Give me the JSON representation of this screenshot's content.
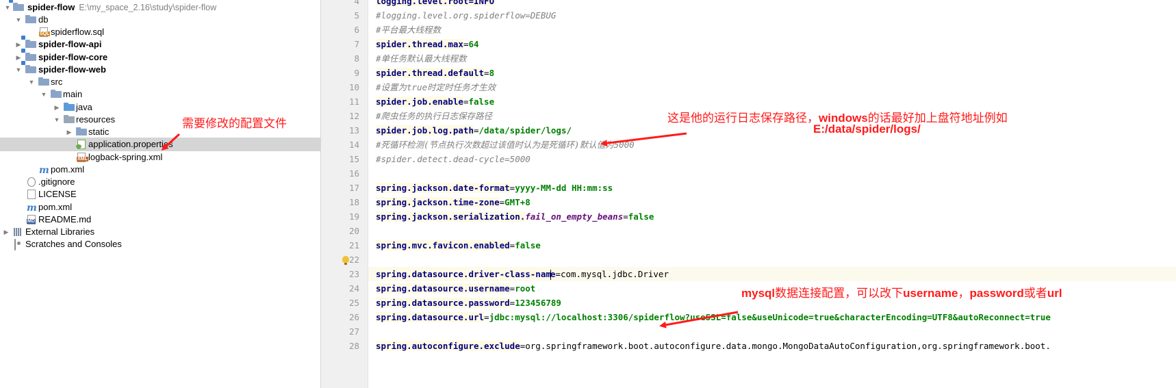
{
  "tree": {
    "root": {
      "name": "spider-flow",
      "path": "E:\\my_space_2.16\\study\\spider-flow"
    },
    "items": [
      {
        "label": "db"
      },
      {
        "label": "spiderflow.sql",
        "icon_tag": "SQL"
      },
      {
        "label": "spider-flow-api"
      },
      {
        "label": "spider-flow-core"
      },
      {
        "label": "spider-flow-web"
      },
      {
        "label": "src"
      },
      {
        "label": "main"
      },
      {
        "label": "java"
      },
      {
        "label": "resources"
      },
      {
        "label": "static"
      },
      {
        "label": "application.properties"
      },
      {
        "label": "logback-spring.xml",
        "icon_tag": "XML"
      },
      {
        "label": "pom.xml"
      },
      {
        "label": ".gitignore"
      },
      {
        "label": "LICENSE"
      },
      {
        "label": "pom.xml"
      },
      {
        "label": "README.md",
        "icon_tag": "MD"
      },
      {
        "label": "External Libraries"
      },
      {
        "label": "Scratches and Consoles"
      }
    ]
  },
  "editor": {
    "lines": [
      {
        "n": "5",
        "comment": "#logging.level.org.spiderflow=DEBUG"
      },
      {
        "n": "6",
        "comment": "#平台最大线程数"
      },
      {
        "n": "7",
        "key": "spider.thread.max",
        "val": "64"
      },
      {
        "n": "8",
        "comment": "#单任务默认最大线程数"
      },
      {
        "n": "9",
        "key": "spider.thread.default",
        "val": "8"
      },
      {
        "n": "10",
        "comment": "#设置为true时定时任务才生效"
      },
      {
        "n": "11",
        "key": "spider.job.enable",
        "val": "false"
      },
      {
        "n": "12",
        "comment": "#爬虫任务的执行日志保存路径"
      },
      {
        "n": "13",
        "key": "spider.job.log.path",
        "val": "/data/spider/logs/"
      },
      {
        "n": "14",
        "comment": "#死循环检测(节点执行次数超过该值时认为是死循环)默认值为5000"
      },
      {
        "n": "15",
        "comment": "#spider.detect.dead-cycle=5000"
      },
      {
        "n": "16"
      },
      {
        "n": "17",
        "key": "spring.jackson.date-format",
        "val": "yyyy-MM-dd HH:mm:ss"
      },
      {
        "n": "18",
        "key": "spring.jackson.time-zone",
        "val": "GMT+8"
      },
      {
        "n": "19",
        "key": "spring.jackson.serialization.",
        "key_italic": "fail_on_empty_beans",
        "val": "false"
      },
      {
        "n": "20"
      },
      {
        "n": "21",
        "key": "spring.mvc.favicon.enabled",
        "val": "false"
      },
      {
        "n": "22"
      },
      {
        "n": "23",
        "key_a": "spring.datasource.driver-class-nam",
        "key_b": "e",
        "val": "com.mysql.jdbc.Driver"
      },
      {
        "n": "24",
        "key": "spring.datasource.username",
        "val": "root"
      },
      {
        "n": "25",
        "key": "spring.datasource.password",
        "val": "123456789"
      },
      {
        "n": "26",
        "key": "spring.datasource.url",
        "val": "jdbc:mysql://localhost:3306/spiderflow?useSSL=false&useUnicode=true&characterEncoding=UTF8&autoReconnect=true"
      },
      {
        "n": "27"
      },
      {
        "n": "28",
        "key": "spring.autoconfigure.exclude",
        "val": "org.springframework.boot.autoconfigure.data.mongo.MongoDataAutoConfiguration,org.springframework.boot."
      }
    ],
    "top_partial": "logging.level.root=INFO"
  },
  "annotations": {
    "config_file": "需要修改的配置文件",
    "log_path_a": "这是他的运行日志保存路径，",
    "log_path_b": "windows",
    "log_path_c": "的话最好加上盘符地址例如",
    "log_path_example": "E:/data/spider/logs/",
    "mysql_a": "mysql",
    "mysql_b": "数据连接配置，可以改下",
    "mysql_c": "username",
    "mysql_d": "，",
    "mysql_e": "password",
    "mysql_f": "或者",
    "mysql_g": "url",
    "color": "#ff1a1a"
  }
}
